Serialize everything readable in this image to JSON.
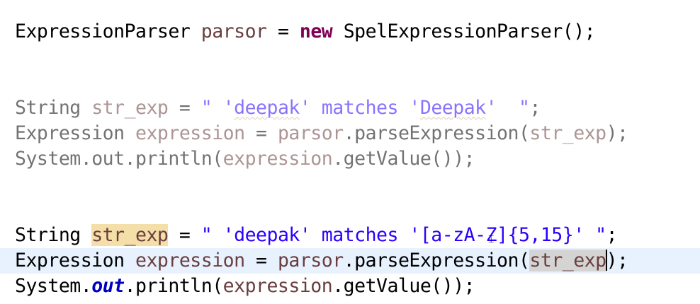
{
  "editor": {
    "line1": {
      "type": "ExpressionParser",
      "var": "parsor",
      "eq": " = ",
      "kw_new": "new",
      "ctor": " SpelExpressionParser();"
    },
    "line2": {
      "type": "String",
      "var": "str_exp",
      "eq": " = ",
      "str_open": "\" '",
      "word1": "deepak",
      "str_mid": "' matches '",
      "word2": "Deepak",
      "str_close": "'  \"",
      "semi": ";"
    },
    "line3": {
      "type": "Expression",
      "var": "expression",
      "eq": " = ",
      "parser": "parsor",
      "call": ".parseExpression(",
      "arg": "str_exp",
      "end": ");"
    },
    "line4": {
      "cls": "System.",
      "field": "out",
      "rest": ".println(",
      "var": "expression",
      "end": ".getValue());"
    },
    "line5": {
      "type": "String",
      "var": "str_exp",
      "eq": " = ",
      "str": "\" 'deepak' matches '[a-zA-Z]{5,15}' \"",
      "semi": ";"
    },
    "line6": {
      "type": "Expression",
      "var": "expression",
      "eq": " = ",
      "parser": "parsor",
      "call": ".parseExpression(",
      "arg": "str_exp",
      "end": ");"
    },
    "line7": {
      "cls": "System.",
      "field": "out",
      "rest": ".println(",
      "var": "expression",
      "end": ".getValue());"
    }
  }
}
